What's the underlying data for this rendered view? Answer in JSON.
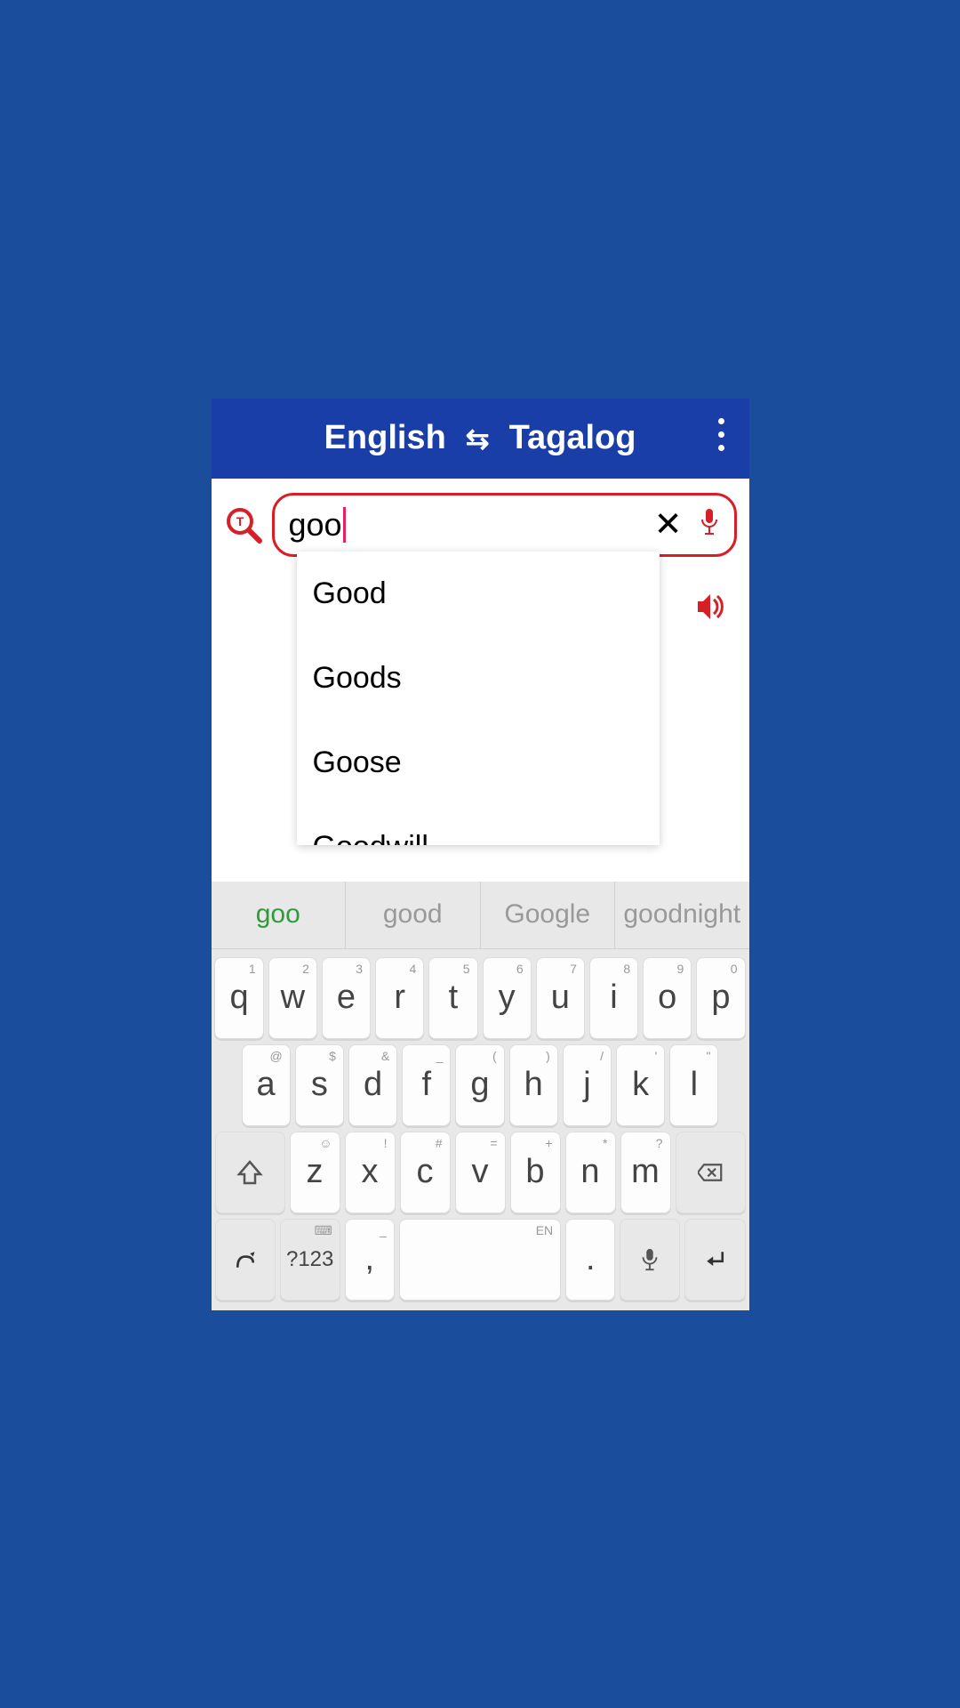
{
  "header": {
    "from": "English",
    "to": "Tagalog"
  },
  "search": {
    "value": "goo"
  },
  "dropdown": [
    "Good",
    "Goods",
    "Goose",
    "Goodwill"
  ],
  "suggestions": [
    "goo",
    "good",
    "Google",
    "goodnight"
  ],
  "keyboard": {
    "row1": [
      {
        "k": "q",
        "s": "1"
      },
      {
        "k": "w",
        "s": "2"
      },
      {
        "k": "e",
        "s": "3"
      },
      {
        "k": "r",
        "s": "4"
      },
      {
        "k": "t",
        "s": "5"
      },
      {
        "k": "y",
        "s": "6"
      },
      {
        "k": "u",
        "s": "7"
      },
      {
        "k": "i",
        "s": "8"
      },
      {
        "k": "o",
        "s": "9"
      },
      {
        "k": "p",
        "s": "0"
      }
    ],
    "row2": [
      {
        "k": "a",
        "s": "@"
      },
      {
        "k": "s",
        "s": "$"
      },
      {
        "k": "d",
        "s": "&"
      },
      {
        "k": "f",
        "s": "_"
      },
      {
        "k": "g",
        "s": "("
      },
      {
        "k": "h",
        "s": ")"
      },
      {
        "k": "j",
        "s": "/"
      },
      {
        "k": "k",
        "s": "'"
      },
      {
        "k": "l",
        "s": "\""
      }
    ],
    "row3": [
      {
        "k": "z",
        "s": "☺"
      },
      {
        "k": "x",
        "s": "!"
      },
      {
        "k": "c",
        "s": "#"
      },
      {
        "k": "v",
        "s": "="
      },
      {
        "k": "b",
        "s": "+"
      },
      {
        "k": "n",
        "s": "*"
      },
      {
        "k": "m",
        "s": "?"
      }
    ],
    "row4": {
      "symnum": "?123",
      "comma": ",",
      "space_lang": "EN",
      "period": "."
    }
  }
}
